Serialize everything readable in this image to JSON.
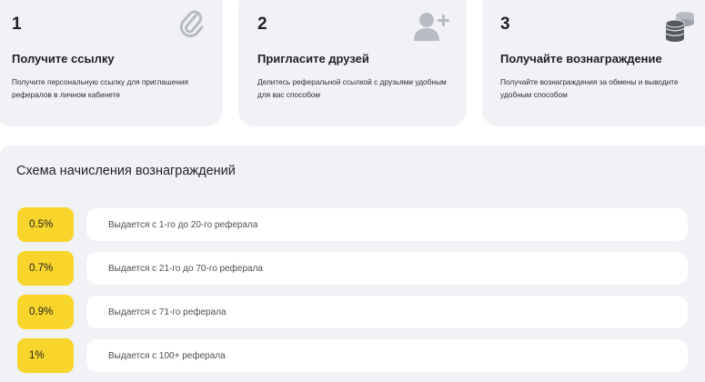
{
  "steps": [
    {
      "number": "1",
      "title": "Получите ссылку",
      "description": "Получите персональную ссылку для приглашения рефералов в личном кабинете",
      "icon": "paperclip-icon"
    },
    {
      "number": "2",
      "title": "Пригласите друзей",
      "description": "Делитесь реферальной ссылкой с друзьями удобным для вас способом",
      "icon": "add-user-icon"
    },
    {
      "number": "3",
      "title": "Получайте вознаграждение",
      "description": "Получайте вознаграждения за обмены и выводите удобным способом",
      "icon": "coins-stack-icon"
    }
  ],
  "scheme": {
    "title": "Схема начисления вознаграждений",
    "tiers": [
      {
        "rate": "0.5%",
        "description": "Выдается с 1-го до 20-го реферала"
      },
      {
        "rate": "0.7%",
        "description": "Выдается с 21-го до 70-го реферала"
      },
      {
        "rate": "0.9%",
        "description": "Выдается с 71-го реферала"
      },
      {
        "rate": "1%",
        "description": "Выдается с 100+ реферала"
      }
    ]
  },
  "colors": {
    "card_background": "#f1f2f6",
    "badge_yellow": "#f8d52b",
    "icon_gray": "#b9bcc4",
    "icon_dark": "#6b6e78"
  }
}
